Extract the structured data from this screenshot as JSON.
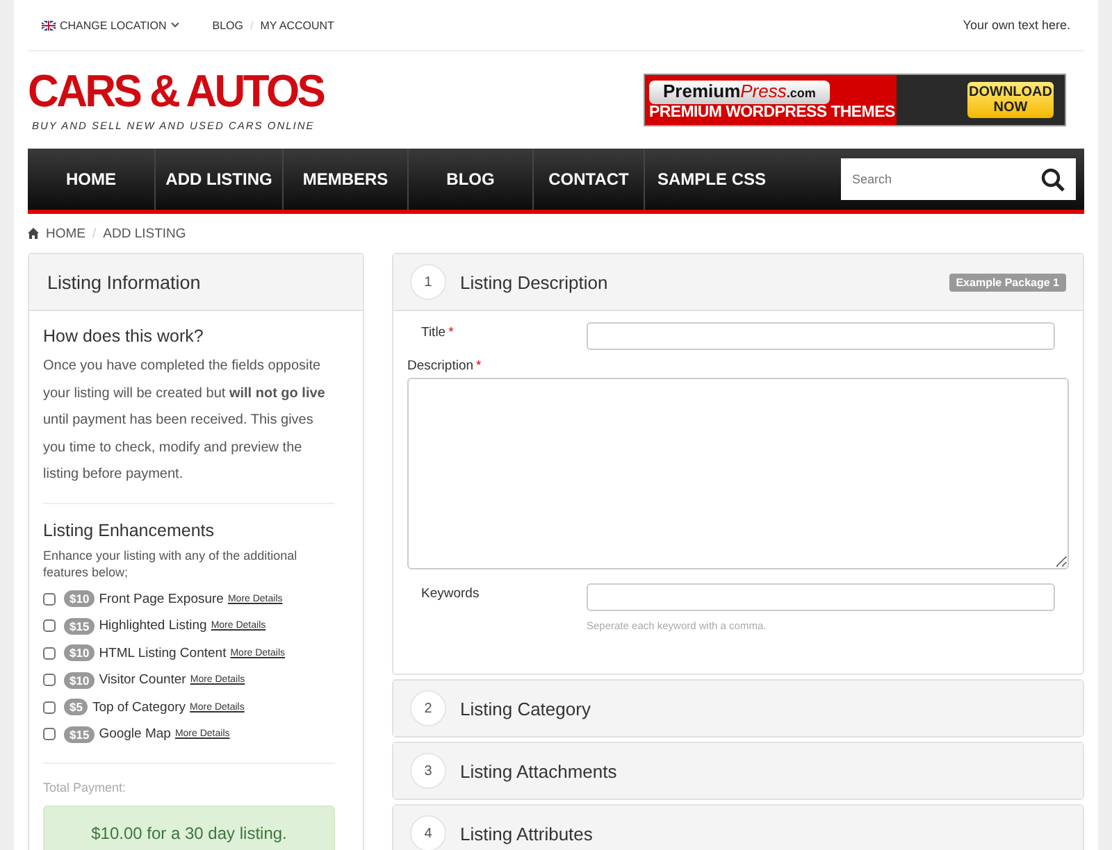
{
  "top_bar": {
    "location": "CHANGE LOCATION",
    "links": [
      "BLOG",
      "MY ACCOUNT"
    ],
    "separator": "/",
    "note": "Your own text here."
  },
  "logo": {
    "title": "CARS & AUTOS",
    "tagline": "BUY AND SELL NEW AND USED CARS ONLINE"
  },
  "banner": {
    "brand": [
      "Premium",
      "Press",
      ".com"
    ],
    "headline": "PREMIUM WORDPRESS THEMES",
    "cta": "DOWNLOAD NOW"
  },
  "nav": {
    "items": [
      "HOME",
      "ADD LISTING",
      "MEMBERS",
      "BLOG",
      "CONTACT",
      "SAMPLE CSS"
    ],
    "search": {
      "placeholder": "Search"
    }
  },
  "breadcrumb": {
    "items": [
      "HOME",
      "ADD LISTING"
    ],
    "separator": "/"
  },
  "sidebar": {
    "title": "Listing Information",
    "how_title": "How does this work?",
    "how_text": "Once you have completed the fields opposite your listing will be created but **will not go live** until payment has been received. This gives you time to check, modify and preview the listing before payment.",
    "enh_title": "Listing Enhancements",
    "enh_text": "Enhance your listing with any of the additional features below;",
    "enhancements": [
      {
        "price": "$10",
        "label": "Front Page Exposure",
        "link": "More Details",
        "checked": false
      },
      {
        "price": "$15",
        "label": "Highlighted Listing",
        "link": "More Details",
        "checked": false
      },
      {
        "price": "$10",
        "label": "HTML Listing Content",
        "link": "More Details",
        "checked": false
      },
      {
        "price": "$10",
        "label": "Visitor Counter",
        "link": "More Details",
        "checked": false
      },
      {
        "price": "$5",
        "label": "Top of Category",
        "link": "More Details",
        "checked": false
      },
      {
        "price": "$15",
        "label": "Google Map",
        "link": "More Details",
        "checked": false
      }
    ],
    "total_label": "Total Payment:",
    "total": "$10.00 for a 30 day listing."
  },
  "steps": [
    {
      "number": "1",
      "title": "Listing Description",
      "badge": "Example Package 1",
      "expanded": true,
      "fields": [
        {
          "kind": "input",
          "label": "Title",
          "required_mark": "*"
        },
        {
          "kind": "textarea",
          "label": "Description",
          "required_mark": "*"
        },
        {
          "kind": "input",
          "label": "Keywords",
          "hint": "Seperate each keyword with a comma."
        }
      ]
    },
    {
      "number": "2",
      "title": "Listing Category",
      "expanded": false
    },
    {
      "number": "3",
      "title": "Listing Attachments",
      "expanded": false
    },
    {
      "number": "4",
      "title": "Listing Attributes",
      "expanded": false
    }
  ]
}
